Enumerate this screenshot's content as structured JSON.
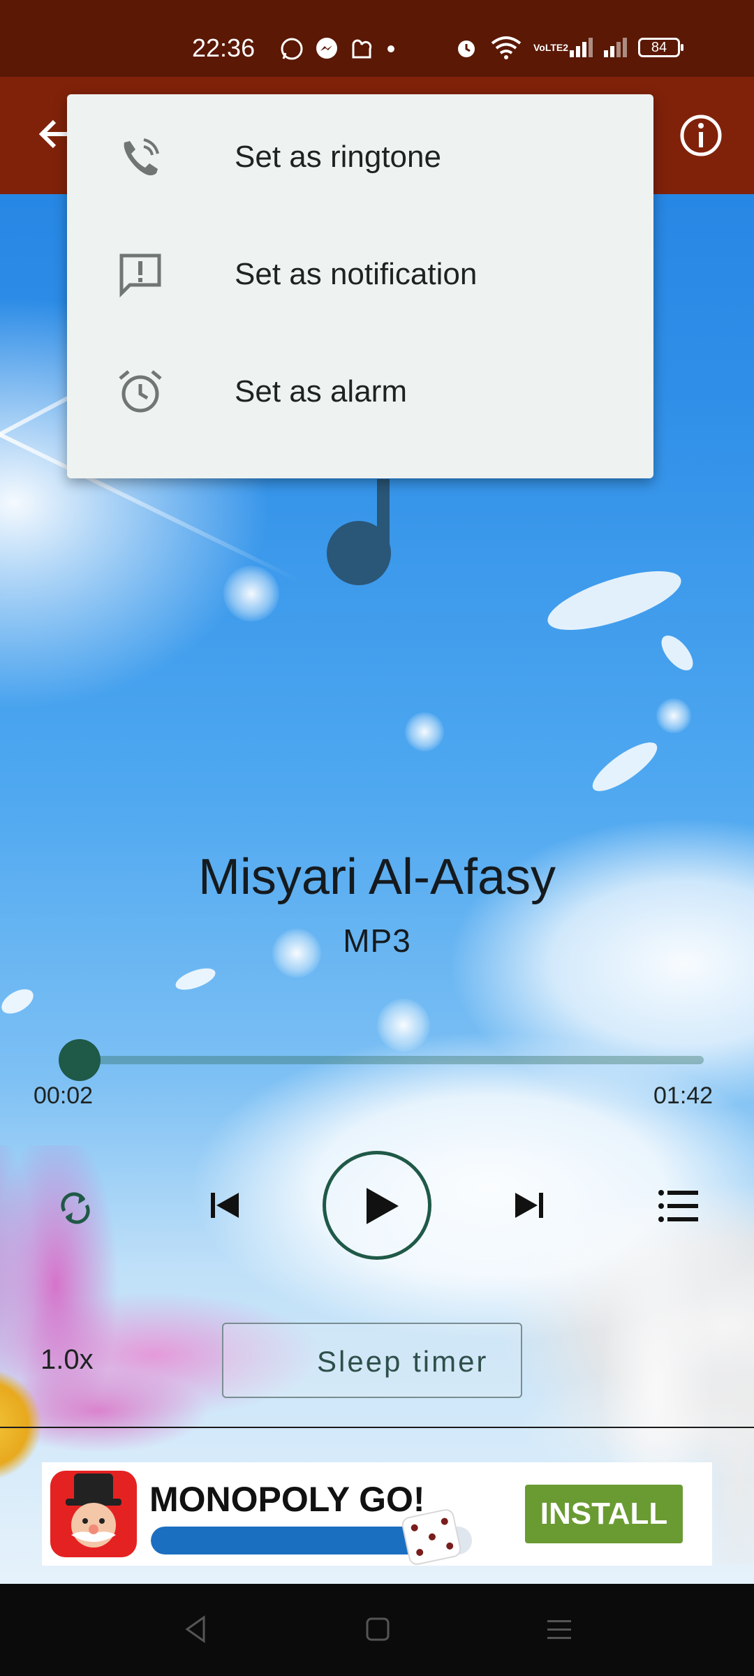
{
  "status_bar": {
    "time": "22:36",
    "battery": "84",
    "network_label": "VoLTE2"
  },
  "toolbar": {
    "back_icon": "arrow-back-icon",
    "info_icon": "info-icon"
  },
  "menu": {
    "items": [
      {
        "label": "Set as ringtone",
        "icon": "phone-ringing-icon"
      },
      {
        "label": "Set as notification",
        "icon": "notification-message-icon"
      },
      {
        "label": "Set as alarm",
        "icon": "alarm-clock-icon"
      }
    ]
  },
  "track": {
    "title": "Misyari Al-Afasy",
    "format": "MP3"
  },
  "player": {
    "elapsed": "00:02",
    "duration": "01:42",
    "progress_fraction": 0.02,
    "speed": "1.0x",
    "sleep_timer_label": "Sleep timer"
  },
  "ad": {
    "title": "MONOPOLY GO!",
    "install_label": "INSTALL",
    "progress_fraction": 0.85
  },
  "colors": {
    "status_bar": "#5a1805",
    "toolbar": "#80220a",
    "accent": "#1f5947",
    "menu_bg": "#eef3f1",
    "install_green": "#6a9b32"
  }
}
